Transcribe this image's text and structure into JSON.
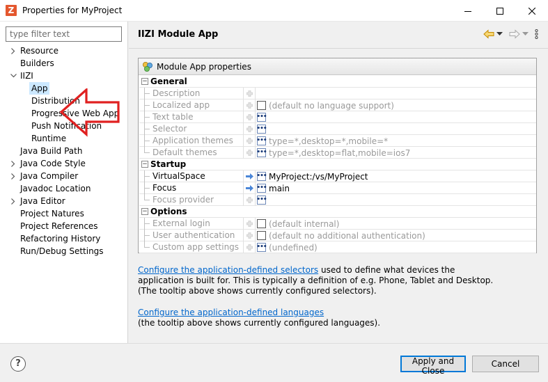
{
  "window": {
    "title": "Properties for MyProject",
    "app_icon_letter": "Z"
  },
  "filter": {
    "placeholder": "type filter text"
  },
  "tree": [
    {
      "label": "Resource",
      "expand": "collapsed",
      "level": 0
    },
    {
      "label": "Builders",
      "expand": "none",
      "level": 0
    },
    {
      "label": "IIZI",
      "expand": "expanded",
      "level": 0
    },
    {
      "label": "App",
      "expand": "none",
      "level": 1,
      "selected": true
    },
    {
      "label": "Distribution",
      "expand": "none",
      "level": 1
    },
    {
      "label": "Progressive Web App",
      "expand": "none",
      "level": 1
    },
    {
      "label": "Push Notification",
      "expand": "none",
      "level": 1
    },
    {
      "label": "Runtime",
      "expand": "none",
      "level": 1
    },
    {
      "label": "Java Build Path",
      "expand": "none",
      "level": 0
    },
    {
      "label": "Java Code Style",
      "expand": "collapsed",
      "level": 0
    },
    {
      "label": "Java Compiler",
      "expand": "collapsed",
      "level": 0
    },
    {
      "label": "Javadoc Location",
      "expand": "none",
      "level": 0
    },
    {
      "label": "Java Editor",
      "expand": "collapsed",
      "level": 0
    },
    {
      "label": "Project Natures",
      "expand": "none",
      "level": 0
    },
    {
      "label": "Project References",
      "expand": "none",
      "level": 0
    },
    {
      "label": "Refactoring History",
      "expand": "none",
      "level": 0
    },
    {
      "label": "Run/Debug Settings",
      "expand": "none",
      "level": 0
    }
  ],
  "page": {
    "title": "IIZI Module App",
    "group_title": "Module App properties"
  },
  "sections": [
    {
      "label": "General",
      "rows": [
        {
          "name": "Description",
          "muted": true,
          "mark": "plus",
          "control": "none",
          "value": ""
        },
        {
          "name": "Localized app",
          "muted": true,
          "mark": "plus",
          "control": "checkbox",
          "value": "(default no language support)",
          "value_dark": false
        },
        {
          "name": "Text table",
          "muted": true,
          "mark": "plus",
          "control": "dots",
          "value": ""
        },
        {
          "name": "Selector",
          "muted": true,
          "mark": "plus",
          "control": "dots",
          "value": ""
        },
        {
          "name": "Application themes",
          "muted": true,
          "mark": "plus",
          "control": "dots",
          "value": "type=*,desktop=*,mobile=*",
          "value_dark": false
        },
        {
          "name": "Default themes",
          "muted": true,
          "mark": "plus",
          "control": "dots",
          "value": "type=*,desktop=flat,mobile=ios7",
          "value_dark": false,
          "last": true
        }
      ]
    },
    {
      "label": "Startup",
      "rows": [
        {
          "name": "VirtualSpace",
          "muted": false,
          "mark": "arrow",
          "control": "dots",
          "value": "MyProject:/vs/MyProject",
          "value_dark": true
        },
        {
          "name": "Focus",
          "muted": false,
          "mark": "arrow",
          "control": "dots",
          "value": "main",
          "value_dark": true
        },
        {
          "name": "Focus provider",
          "muted": true,
          "mark": "plus",
          "control": "dots",
          "value": "",
          "last": true
        }
      ]
    },
    {
      "label": "Options",
      "rows": [
        {
          "name": "External login",
          "muted": true,
          "mark": "plus",
          "control": "checkbox",
          "value": "(default internal)",
          "value_dark": false
        },
        {
          "name": "User authentication",
          "muted": true,
          "mark": "plus",
          "control": "checkbox",
          "value": "(default no additional authentication)",
          "value_dark": false
        },
        {
          "name": "Custom app settings",
          "muted": true,
          "mark": "plus",
          "control": "dots",
          "value": "(undefined)",
          "value_dark": false,
          "last": true
        }
      ]
    }
  ],
  "help1": {
    "link": "Configure the application-defined selectors",
    "line1": " used to define what devices the",
    "line2": "application is built for. This is typically a definition of e.g. Phone, Tablet and Desktop.",
    "line3": "(The tooltip above shows currently configured selectors)."
  },
  "help2": {
    "link": "Configure the application-defined languages",
    "line2": "(the tooltip above shows currently configured languages)."
  },
  "buttons": {
    "apply_close": "Apply and Close",
    "cancel": "Cancel",
    "help": "?"
  },
  "colors": {
    "selection": "#cce8ff",
    "link": "#0066cc",
    "arrow": "#e02020",
    "primary_border": "#0078d7"
  }
}
